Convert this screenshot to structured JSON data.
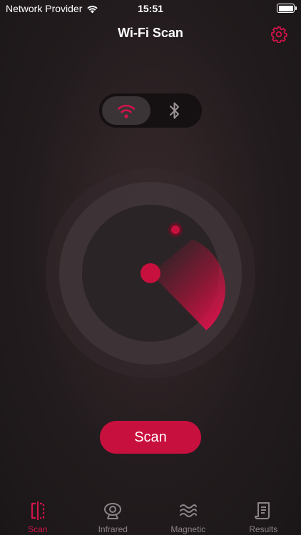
{
  "status_bar": {
    "carrier": "Network Provider",
    "time": "15:51"
  },
  "header": {
    "title": "Wi-Fi Scan",
    "settings_icon": "gear-icon"
  },
  "mode_toggle": {
    "options": [
      {
        "icon": "wifi-icon",
        "active": true
      },
      {
        "icon": "bluetooth-icon",
        "active": false
      }
    ]
  },
  "radar": {
    "detected_devices": 1
  },
  "scan_button": {
    "label": "Scan"
  },
  "tabs": [
    {
      "label": "Scan",
      "icon": "scan-split-icon",
      "active": true
    },
    {
      "label": "Infrared",
      "icon": "webcam-icon",
      "active": false
    },
    {
      "label": "Magnetic",
      "icon": "waves-icon",
      "active": false
    },
    {
      "label": "Results",
      "icon": "document-icon",
      "active": false
    }
  ],
  "colors": {
    "accent": "#c8103e",
    "accent_light": "#e0185a",
    "background": "#231c1e",
    "inactive": "#8c8486"
  }
}
